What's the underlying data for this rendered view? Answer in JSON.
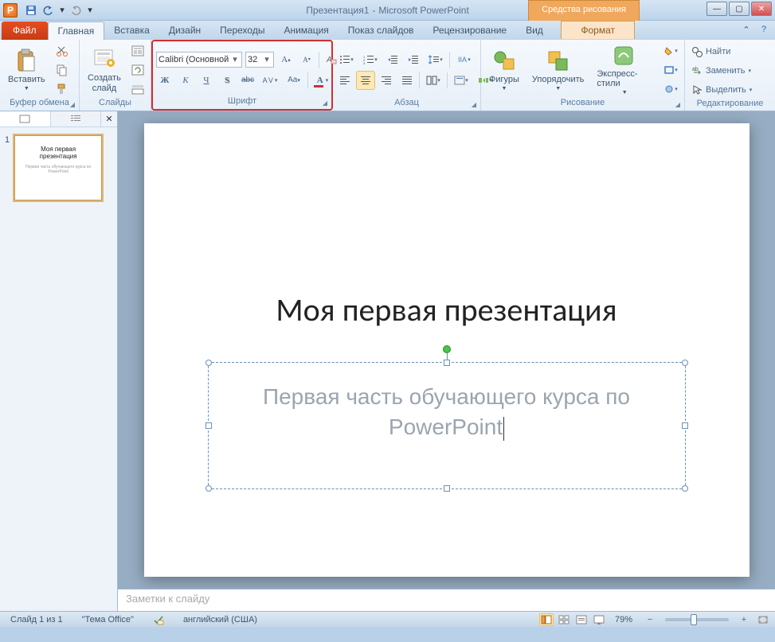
{
  "titlebar": {
    "doc_name": "Презентация1",
    "app_name": "Microsoft PowerPoint",
    "separator": "-",
    "contextual_header": "Средства рисования"
  },
  "tabs": {
    "file": "Файл",
    "items": [
      "Главная",
      "Вставка",
      "Дизайн",
      "Переходы",
      "Анимация",
      "Показ слайдов",
      "Рецензирование",
      "Вид"
    ],
    "active_index": 0,
    "contextual": "Формат"
  },
  "ribbon": {
    "clipboard": {
      "label": "Буфер обмена",
      "paste": "Вставить"
    },
    "slides": {
      "label": "Слайды",
      "new_slide": "Создать\nслайд"
    },
    "font": {
      "label": "Шрифт",
      "font_name": "Calibri (Основной",
      "font_size": "32"
    },
    "paragraph": {
      "label": "Абзац"
    },
    "drawing": {
      "label": "Рисование",
      "shapes": "Фигуры",
      "arrange": "Упорядочить",
      "quick_styles": "Экспресс-стили"
    },
    "editing": {
      "label": "Редактирование",
      "find": "Найти",
      "replace": "Заменить",
      "select": "Выделить"
    }
  },
  "slide_panel": {
    "tab_slides_icon": "▭",
    "tab_outline_icon": "≡",
    "thumb_number": "1",
    "thumb_title": "Моя первая презентация",
    "thumb_subtitle": "Первая часть обучающего курса по PowerPoint"
  },
  "slide": {
    "title": "Моя первая презентация",
    "subtitle": "Первая часть обучающего курса по PowerPoint"
  },
  "notes": {
    "placeholder": "Заметки к слайду"
  },
  "statusbar": {
    "slide_of": "Слайд 1 из 1",
    "theme": "\"Тема Office\"",
    "language": "английский (США)",
    "zoom_pct": "79%",
    "zoom_pos_pct": 40
  }
}
